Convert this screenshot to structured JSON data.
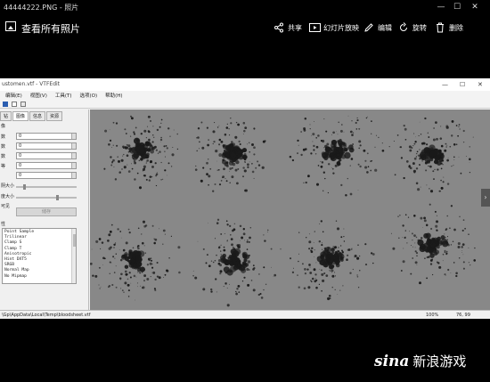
{
  "window": {
    "title": "44444222.PNG - 照片"
  },
  "appbar": {
    "view_all": "查看所有照片",
    "actions": [
      {
        "icon": "share-icon",
        "label": "共享"
      },
      {
        "icon": "slideshow-icon",
        "label": "幻灯片放映"
      },
      {
        "icon": "edit-icon",
        "label": "编辑"
      },
      {
        "icon": "rotate-icon",
        "label": "旋转"
      },
      {
        "icon": "delete-icon",
        "label": "删除"
      }
    ]
  },
  "inner": {
    "title": "ustomen.vtf - VTFEdit",
    "menu": [
      "编辑(E)",
      "视图(V)",
      "工具(T)",
      "选项(O)",
      "帮助(H)"
    ],
    "tabs": [
      "钻",
      "图像",
      "信息",
      "资源"
    ],
    "side_labels": [
      "像",
      "数",
      "数",
      "数",
      "等",
      "阴大小",
      "度大小",
      "可见"
    ],
    "field_values": [
      "0",
      "0",
      "0",
      "0",
      "0"
    ],
    "apply_label": "储存",
    "list_label": "性",
    "list_items": [
      "Point Sample",
      "Trilinear",
      "Clamp S",
      "Clamp T",
      "Anisotropic",
      "Hint DXT5",
      "SRGB",
      "Normal Map",
      "No Mipmap"
    ],
    "status_path": "\\Gp\\AppData\\Local\\Temp\\bloodsheet.vtf",
    "status_zoom": "100%",
    "status_coords": "76, 99"
  },
  "watermark": {
    "logo": "sina",
    "text": "新浪游戏"
  },
  "colors": {
    "photos_bg": "#000000",
    "canvas_bg": "#888888",
    "splatter": "#1a1a1a"
  }
}
